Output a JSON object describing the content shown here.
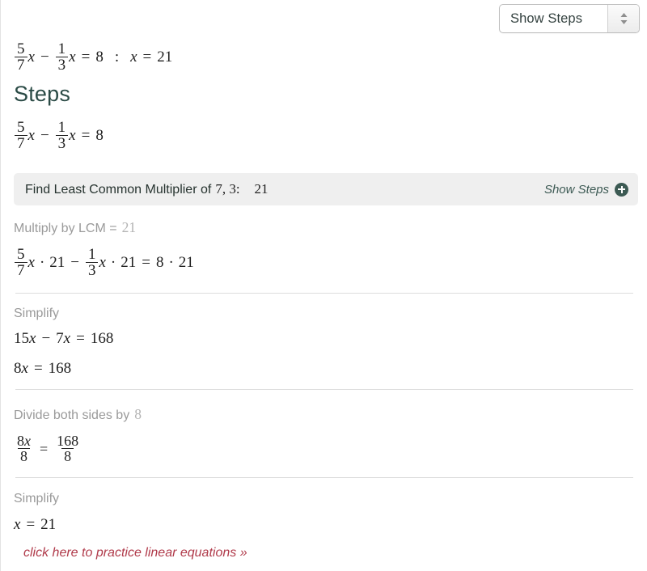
{
  "toolbar": {
    "select_value": "Show Steps",
    "spinner_icon": "updown-spinner-icon"
  },
  "query": {
    "frac1_num": "5",
    "frac1_den": "7",
    "var": "x",
    "minus": "−",
    "frac2_num": "1",
    "frac2_den": "3",
    "equals": "=",
    "rhs": "8",
    "separator": ":",
    "answer_var": "x",
    "answer_equals": "=",
    "answer_value": "21"
  },
  "steps_heading": "Steps",
  "restate": {
    "frac1_num": "5",
    "frac1_den": "7",
    "var": "x",
    "minus": "−",
    "frac2_num": "1",
    "frac2_den": "3",
    "equals": "=",
    "rhs": "8"
  },
  "lcm_panel": {
    "text_prefix": "Find Least Common Multiplier of",
    "numbers": "7, 3:",
    "value": "21",
    "show_steps_label": "Show Steps",
    "expand_icon": "plus-circle-icon"
  },
  "step1": {
    "label": "Multiply by LCM =",
    "value": "21",
    "eq": {
      "frac1_num": "5",
      "frac1_den": "7",
      "var": "x",
      "dot": "·",
      "mult1": "21",
      "minus": "−",
      "frac2_num": "1",
      "frac2_den": "3",
      "mult2": "21",
      "equals": "=",
      "rhs": "8",
      "rhs_mult": "21"
    }
  },
  "step2": {
    "label": "Simplify",
    "line1": {
      "a": "15",
      "var1": "x",
      "minus": "−",
      "b": "7",
      "var2": "x",
      "equals": "=",
      "rhs": "168"
    },
    "line2": {
      "a": "8",
      "var1": "x",
      "equals": "=",
      "rhs": "168"
    }
  },
  "step3": {
    "label": "Divide both sides by",
    "value": "8",
    "eq": {
      "lhs_num_coef": "8",
      "lhs_num_var": "x",
      "lhs_den": "8",
      "equals": "=",
      "rhs_num": "168",
      "rhs_den": "8"
    }
  },
  "step4": {
    "label": "Simplify",
    "eq": {
      "var": "x",
      "equals": "=",
      "value": "21"
    }
  },
  "practice_link": "click here to practice linear equations »",
  "colors": {
    "panel_bg": "#efefef",
    "link": "#b03a4a",
    "heading": "#2b4b46",
    "muted": "#9a9a9a",
    "divider": "#dcdcdc"
  }
}
